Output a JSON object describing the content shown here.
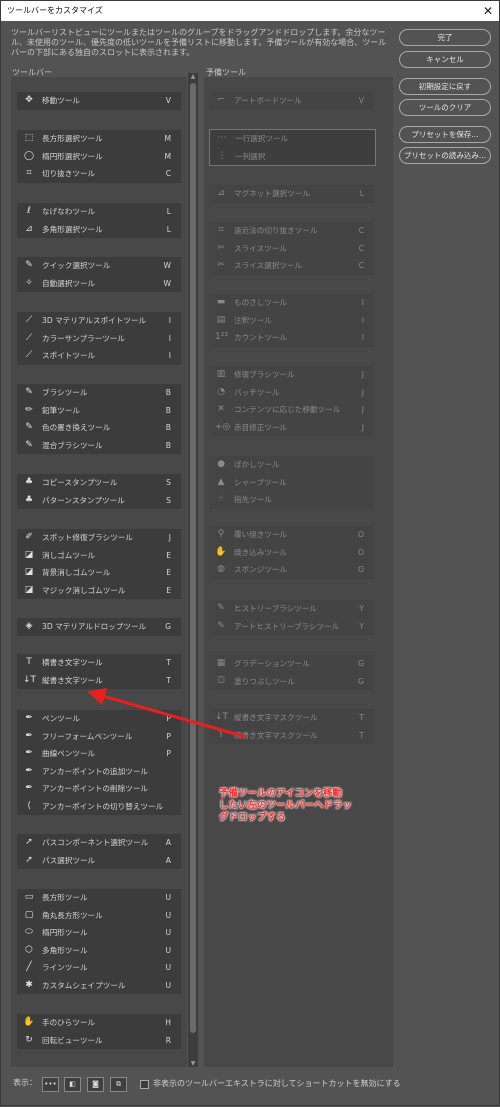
{
  "window": {
    "title": "ツールバーをカスタマイズ",
    "close": "✕"
  },
  "description": "ツールバーリストビューにツールまたはツールのグループをドラッグアンドドロップします。余分なツール、未使用のツール、優先度の低いツールを予備リストに移動します。予備ツールが有効な場合、ツールバーの下部にある独自のスロットに表示されます。",
  "toolbar_header": "ツールバー",
  "reserve_header": "予備ツール",
  "toolbar_groups": [
    [
      {
        "icon": "move-icon",
        "glyph": "✥",
        "label": "移動ツール",
        "key": "V"
      }
    ],
    [
      {
        "icon": "rect-marquee-icon",
        "glyph": "⬚",
        "label": "長方形選択ツール",
        "key": "M"
      },
      {
        "icon": "ellipse-marquee-icon",
        "glyph": "◯",
        "label": "楕円形選択ツール",
        "key": "M"
      },
      {
        "icon": "crop-icon",
        "glyph": "⌗",
        "label": "切り抜きツール",
        "key": "C"
      }
    ],
    [
      {
        "icon": "lasso-icon",
        "glyph": "ℓ",
        "label": "なげなわツール",
        "key": "L"
      },
      {
        "icon": "polygon-lasso-icon",
        "glyph": "⊿",
        "label": "多角形選択ツール",
        "key": "L"
      }
    ],
    [
      {
        "icon": "quick-select-icon",
        "glyph": "✎",
        "label": "クイック選択ツール",
        "key": "W"
      },
      {
        "icon": "magic-wand-icon",
        "glyph": "✧",
        "label": "自動選択ツール",
        "key": "W"
      }
    ],
    [
      {
        "icon": "3d-eyedropper-icon",
        "glyph": "⟋",
        "label": "3D マテリアルスポイトツール",
        "key": "I"
      },
      {
        "icon": "color-sampler-icon",
        "glyph": "⟋",
        "label": "カラーサンプラーツール",
        "key": "I"
      },
      {
        "icon": "eyedropper-icon",
        "glyph": "⟋",
        "label": "スポイトツール",
        "key": "I"
      }
    ],
    [
      {
        "icon": "brush-icon",
        "glyph": "✎",
        "label": "ブラシツール",
        "key": "B"
      },
      {
        "icon": "pencil-icon",
        "glyph": "✏",
        "label": "鉛筆ツール",
        "key": "B"
      },
      {
        "icon": "color-replace-icon",
        "glyph": "✎",
        "label": "色の置き換えツール",
        "key": "B"
      },
      {
        "icon": "mixer-brush-icon",
        "glyph": "✎",
        "label": "混合ブラシツール",
        "key": "B"
      }
    ],
    [
      {
        "icon": "clone-stamp-icon",
        "glyph": "♣",
        "label": "コピースタンプツール",
        "key": "S"
      },
      {
        "icon": "pattern-stamp-icon",
        "glyph": "♣",
        "label": "パターンスタンプツール",
        "key": "S"
      }
    ],
    [
      {
        "icon": "spot-heal-icon",
        "glyph": "✐",
        "label": "スポット修復ブラシツール",
        "key": "J"
      },
      {
        "icon": "eraser-icon",
        "glyph": "◪",
        "label": "消しゴムツール",
        "key": "E"
      },
      {
        "icon": "bg-eraser-icon",
        "glyph": "◪",
        "label": "背景消しゴムツール",
        "key": "E"
      },
      {
        "icon": "magic-eraser-icon",
        "glyph": "◪",
        "label": "マジック消しゴムツール",
        "key": "E"
      }
    ],
    [
      {
        "icon": "3d-material-drop-icon",
        "glyph": "◈",
        "label": "3D マテリアルドロップツール",
        "key": "G"
      }
    ],
    [
      {
        "icon": "horizontal-type-icon",
        "glyph": "T",
        "label": "横書き文字ツール",
        "key": "T"
      },
      {
        "icon": "vertical-type-icon",
        "glyph": "↓T",
        "label": "縦書き文字ツール",
        "key": "T"
      }
    ],
    [
      {
        "icon": "pen-icon",
        "glyph": "✒",
        "label": "ペンツール",
        "key": "P"
      },
      {
        "icon": "freeform-pen-icon",
        "glyph": "✒",
        "label": "フリーフォームペンツール",
        "key": "P"
      },
      {
        "icon": "curvature-pen-icon",
        "glyph": "✒",
        "label": "曲線ペンツール",
        "key": "P"
      },
      {
        "icon": "add-anchor-icon",
        "glyph": "✒",
        "label": "アンカーポイントの追加ツール",
        "key": ""
      },
      {
        "icon": "delete-anchor-icon",
        "glyph": "✒",
        "label": "アンカーポイントの削除ツール",
        "key": ""
      },
      {
        "icon": "convert-point-icon",
        "glyph": "⟨",
        "label": "アンカーポイントの切り替えツール",
        "key": ""
      }
    ],
    [
      {
        "icon": "path-select-icon",
        "glyph": "➚",
        "label": "パスコンポーネント選択ツール",
        "key": "A"
      },
      {
        "icon": "direct-select-icon",
        "glyph": "➚",
        "label": "パス選択ツール",
        "key": "A"
      }
    ],
    [
      {
        "icon": "rectangle-icon",
        "glyph": "▭",
        "label": "長方形ツール",
        "key": "U"
      },
      {
        "icon": "rounded-rect-icon",
        "glyph": "▢",
        "label": "角丸長方形ツール",
        "key": "U"
      },
      {
        "icon": "ellipse-icon",
        "glyph": "⬭",
        "label": "楕円形ツール",
        "key": "U"
      },
      {
        "icon": "polygon-icon",
        "glyph": "⬡",
        "label": "多角形ツール",
        "key": "U"
      },
      {
        "icon": "line-icon",
        "glyph": "╱",
        "label": "ラインツール",
        "key": "U"
      },
      {
        "icon": "custom-shape-icon",
        "glyph": "✱",
        "label": "カスタムシェイプツール",
        "key": "U"
      }
    ],
    [
      {
        "icon": "hand-icon",
        "glyph": "✋",
        "label": "手のひらツール",
        "key": "H"
      },
      {
        "icon": "rotate-view-icon",
        "glyph": "↻",
        "label": "回転ビューツール",
        "key": "R"
      }
    ]
  ],
  "reserve_groups": [
    [
      {
        "icon": "artboard-icon",
        "glyph": "⌐",
        "label": "アートボードツール",
        "key": "V"
      }
    ],
    [
      {
        "icon": "single-row-icon",
        "glyph": "⋯",
        "label": "一行選択ツール",
        "key": ""
      },
      {
        "icon": "single-column-icon",
        "glyph": "⋮",
        "label": "一列選択",
        "key": ""
      }
    ],
    [
      {
        "icon": "magnetic-lasso-icon",
        "glyph": "⊿",
        "label": "マグネット選択ツール",
        "key": "L"
      }
    ],
    [
      {
        "icon": "perspective-crop-icon",
        "glyph": "⌗",
        "label": "遠近法の切り抜きツール",
        "key": "C"
      },
      {
        "icon": "slice-icon",
        "glyph": "✂",
        "label": "スライスツール",
        "key": "C"
      },
      {
        "icon": "slice-select-icon",
        "glyph": "✂",
        "label": "スライス選択ツール",
        "key": "C"
      }
    ],
    [
      {
        "icon": "ruler-icon",
        "glyph": "▬",
        "label": "ものさしツール",
        "key": "I"
      },
      {
        "icon": "note-icon",
        "glyph": "▤",
        "label": "注釈ツール",
        "key": "I"
      },
      {
        "icon": "count-icon",
        "glyph": "1²³",
        "label": "カウントツール",
        "key": "I"
      }
    ],
    [
      {
        "icon": "healing-brush-icon",
        "glyph": "▥",
        "label": "修復ブラシツール",
        "key": "J"
      },
      {
        "icon": "patch-icon",
        "glyph": "◔",
        "label": "パッチツール",
        "key": "J"
      },
      {
        "icon": "content-aware-move-icon",
        "glyph": "✕",
        "label": "コンテンツに応じた移動ツール",
        "key": "J"
      },
      {
        "icon": "red-eye-icon",
        "glyph": "+◎",
        "label": "赤目修正ツール",
        "key": "J"
      }
    ],
    [
      {
        "icon": "blur-icon",
        "glyph": "●",
        "label": "ぼかしツール",
        "key": ""
      },
      {
        "icon": "sharpen-icon",
        "glyph": "▲",
        "label": "シャープツール",
        "key": ""
      },
      {
        "icon": "smudge-icon",
        "glyph": "☝",
        "label": "指先ツール",
        "key": ""
      }
    ],
    [
      {
        "icon": "dodge-icon",
        "glyph": "⚲",
        "label": "覆い焼きツール",
        "key": "O"
      },
      {
        "icon": "burn-icon",
        "glyph": "✋",
        "label": "焼き込みツール",
        "key": "O"
      },
      {
        "icon": "sponge-icon",
        "glyph": "◍",
        "label": "スポンジツール",
        "key": "O"
      }
    ],
    [
      {
        "icon": "history-brush-icon",
        "glyph": "✎",
        "label": "ヒストリーブラシツール",
        "key": "Y"
      },
      {
        "icon": "art-history-brush-icon",
        "glyph": "✎",
        "label": "アートヒストリーブラシツール",
        "key": "Y"
      }
    ],
    [
      {
        "icon": "gradient-icon",
        "glyph": "▦",
        "label": "グラデーションツール",
        "key": "G"
      },
      {
        "icon": "paint-bucket-icon",
        "glyph": "⛋",
        "label": "塗りつぶしツール",
        "key": "G"
      }
    ],
    [
      {
        "icon": "vertical-type-mask-icon",
        "glyph": "↓T",
        "label": "縦書き文字マスクツール",
        "key": "T"
      },
      {
        "icon": "horizontal-type-mask-icon",
        "glyph": "T",
        "label": "横書き文字マスクツール",
        "key": "T"
      }
    ]
  ],
  "buttons": {
    "done": "完了",
    "cancel": "キャンセル",
    "reset": "初期設定に戻す",
    "clear": "ツールのクリア",
    "save_preset": "プリセットを保存...",
    "load_preset": "プリセットの読み込み..."
  },
  "bottom": {
    "show_label": "表示：",
    "checkbox_label": "非表示のツールバーエキストラに対してショートカットを無効にする"
  },
  "annotation": {
    "line1": "予備ツールのアイコンを移動",
    "line2": "したい左のツールバーへドラッ",
    "line3": "グドロップする",
    "color": "#ff2a2a"
  }
}
